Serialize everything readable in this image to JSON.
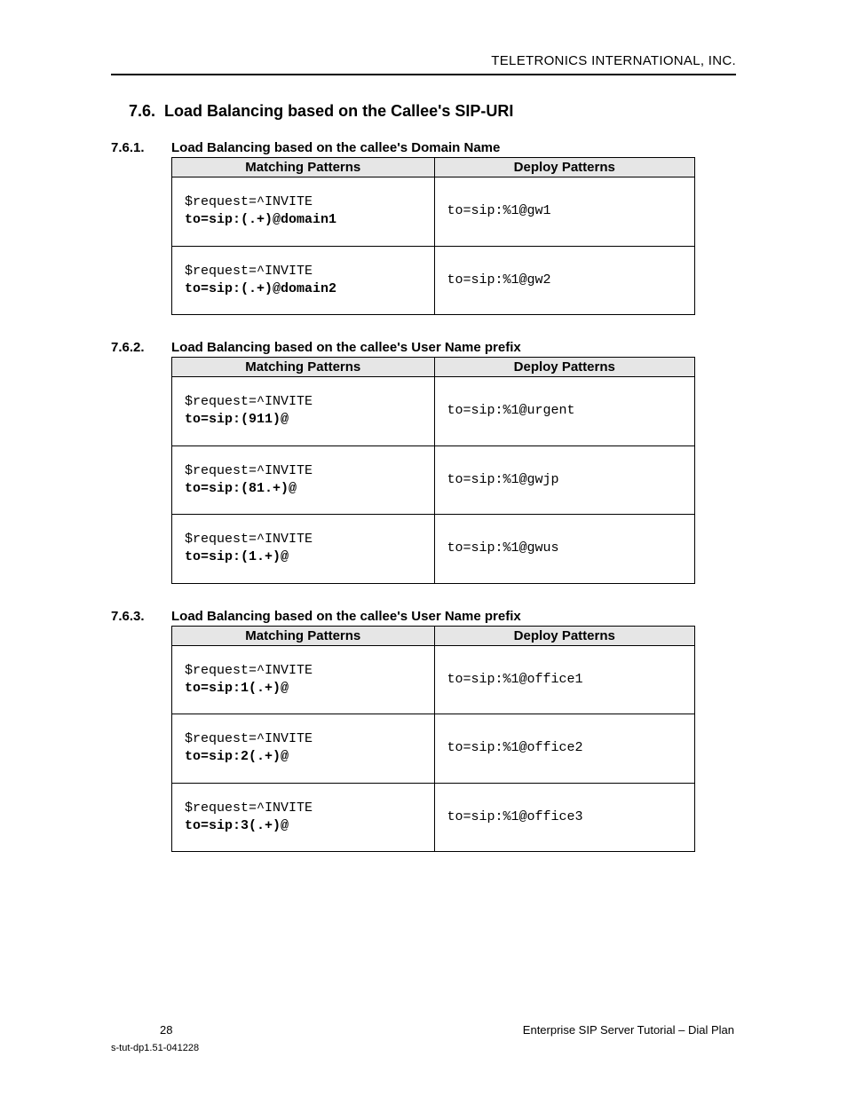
{
  "header": {
    "company": "TELETRONICS INTERNATIONAL, INC."
  },
  "section": {
    "number": "7.6.",
    "title": "Load Balancing based on the Callee's SIP-URI"
  },
  "subsections": [
    {
      "number": "7.6.1.",
      "title": "Load Balancing based on the callee's Domain Name",
      "table": {
        "headers": {
          "left": "Matching Patterns",
          "right": "Deploy Patterns"
        },
        "rows": [
          {
            "match_line1": "$request=^INVITE",
            "match_line2": "to=sip:(.+)@domain1",
            "deploy": "to=sip:%1@gw1"
          },
          {
            "match_line1": "$request=^INVITE",
            "match_line2": "to=sip:(.+)@domain2",
            "deploy": "to=sip:%1@gw2"
          }
        ]
      }
    },
    {
      "number": "7.6.2.",
      "title": "Load Balancing based on the callee's User Name prefix",
      "table": {
        "headers": {
          "left": "Matching Patterns",
          "right": "Deploy Patterns"
        },
        "rows": [
          {
            "match_line1": "$request=^INVITE",
            "match_line2": "to=sip:(911)@",
            "deploy": "to=sip:%1@urgent"
          },
          {
            "match_line1": "$request=^INVITE",
            "match_line2": "to=sip:(81.+)@",
            "deploy": "to=sip:%1@gwjp"
          },
          {
            "match_line1": "$request=^INVITE",
            "match_line2": "to=sip:(1.+)@",
            "deploy": "to=sip:%1@gwus"
          }
        ]
      }
    },
    {
      "number": "7.6.3.",
      "title": "Load Balancing based on the callee's User Name prefix",
      "table": {
        "headers": {
          "left": "Matching Patterns",
          "right": "Deploy Patterns"
        },
        "rows": [
          {
            "match_line1": "$request=^INVITE",
            "match_line2": "to=sip:1(.+)@",
            "deploy": "to=sip:%1@office1"
          },
          {
            "match_line1": "$request=^INVITE",
            "match_line2": "to=sip:2(.+)@",
            "deploy": "to=sip:%1@office2"
          },
          {
            "match_line1": "$request=^INVITE",
            "match_line2": "to=sip:3(.+)@",
            "deploy": "to=sip:%1@office3"
          }
        ]
      }
    }
  ],
  "footer": {
    "page": "28",
    "doc_title": "Enterprise SIP Server Tutorial – Dial Plan",
    "doc_id": "s-tut-dp1.51-041228"
  }
}
